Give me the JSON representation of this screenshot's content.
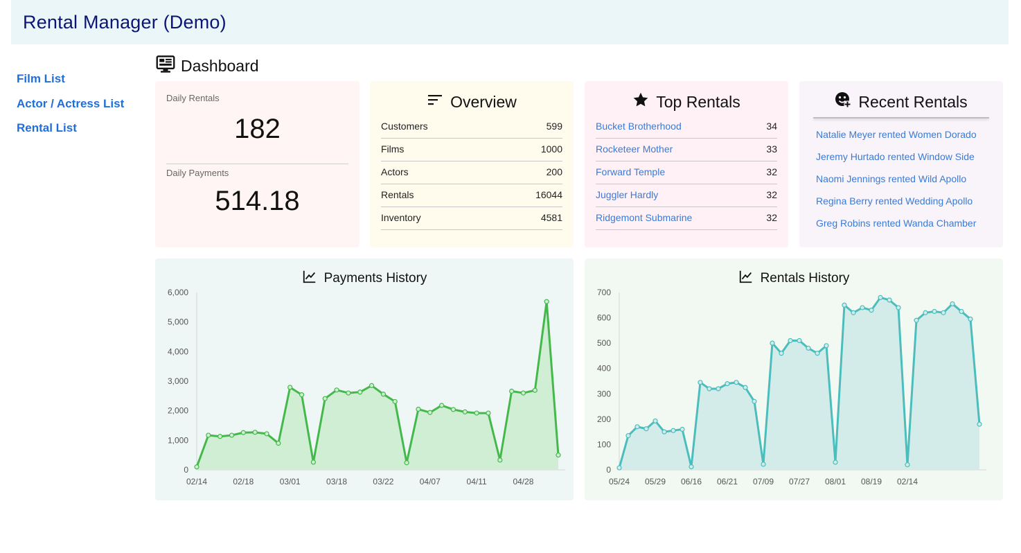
{
  "app": {
    "title": "Rental Manager (Demo)"
  },
  "sidebar": {
    "items": [
      {
        "label": "Film List"
      },
      {
        "label": "Actor / Actress List"
      },
      {
        "label": "Rental List"
      }
    ]
  },
  "dashboard": {
    "title": "Dashboard",
    "icon": "monitor-icon"
  },
  "daily": {
    "rentals_label": "Daily Rentals",
    "rentals_value": "182",
    "payments_label": "Daily Payments",
    "payments_value": "514.18"
  },
  "overview": {
    "title": "Overview",
    "icon": "sort-lines-icon",
    "rows": [
      {
        "label": "Customers",
        "value": "599"
      },
      {
        "label": "Films",
        "value": "1000"
      },
      {
        "label": "Actors",
        "value": "200"
      },
      {
        "label": "Rentals",
        "value": "16044"
      },
      {
        "label": "Inventory",
        "value": "4581"
      }
    ]
  },
  "top_rentals": {
    "title": "Top Rentals",
    "icon": "star-icon",
    "rows": [
      {
        "label": "Bucket Brotherhood",
        "value": "34"
      },
      {
        "label": "Rocketeer Mother",
        "value": "33"
      },
      {
        "label": "Forward Temple",
        "value": "32"
      },
      {
        "label": "Juggler Hardly",
        "value": "32"
      },
      {
        "label": "Ridgemont Submarine",
        "value": "32"
      }
    ]
  },
  "recent_rentals": {
    "title": "Recent Rentals",
    "icon": "emoji-add-icon",
    "items": [
      "Natalie Meyer rented Women Dorado",
      "Jeremy Hurtado rented Window Side",
      "Naomi Jennings rented Wild Apollo",
      "Regina Berry rented Wedding Apollo",
      "Greg Robins rented Wanda Chamber"
    ]
  },
  "colors": {
    "accent_blue": "#1f6fdb",
    "title_navy": "#0b1574",
    "payments_line": "#45b84b",
    "payments_fill": "#cfeed3",
    "rentals_line": "#4bbdbd",
    "rentals_fill": "#d3ecea"
  },
  "chart_data": [
    {
      "type": "area",
      "title": "Payments History",
      "icon": "line-chart-icon",
      "xlabel": "",
      "ylabel": "",
      "ylim": [
        0,
        6000
      ],
      "yticks": [
        "0",
        "1,000",
        "2,000",
        "3,000",
        "4,000",
        "5,000",
        "6,000"
      ],
      "ytick_values": [
        0,
        1000,
        2000,
        3000,
        4000,
        5000,
        6000
      ],
      "x": [
        "02/14",
        "02/15",
        "02/16",
        "02/17",
        "02/18",
        "02/19",
        "02/20",
        "02/21",
        "03/01",
        "03/02",
        "03/03",
        "03/18",
        "03/19",
        "03/20",
        "03/21",
        "03/22",
        "03/23",
        "03/24",
        "04/06",
        "04/07",
        "04/08",
        "04/09",
        "04/10",
        "04/11",
        "04/12",
        "04/27",
        "04/28",
        "04/29",
        "04/30",
        "05/01",
        "05/02",
        "05/03"
      ],
      "xtick_labels": [
        "02/14",
        "02/18",
        "03/01",
        "03/18",
        "03/22",
        "04/07",
        "04/11",
        "04/28"
      ],
      "xtick_index": [
        0,
        4,
        8,
        12,
        16,
        20,
        24,
        28
      ],
      "series": [
        {
          "values": [
            100,
            1170,
            1130,
            1170,
            1260,
            1270,
            1220,
            900,
            2790,
            2540,
            260,
            2410,
            2700,
            2600,
            2630,
            2850,
            2560,
            2310,
            240,
            2050,
            1940,
            2180,
            2040,
            1960,
            1920,
            1920,
            330,
            2660,
            2600,
            2690,
            5690,
            500
          ]
        }
      ],
      "grid": false
    },
    {
      "type": "area",
      "title": "Rentals History",
      "icon": "line-chart-icon",
      "xlabel": "",
      "ylabel": "",
      "ylim": [
        0,
        700
      ],
      "yticks": [
        "0",
        "100",
        "200",
        "300",
        "400",
        "500",
        "600",
        "700"
      ],
      "ytick_values": [
        0,
        100,
        200,
        300,
        400,
        500,
        600,
        700
      ],
      "x": [
        "05/24",
        "05/25",
        "05/26",
        "05/27",
        "05/28",
        "05/29",
        "05/30",
        "05/31",
        "06/01",
        "06/14",
        "06/15",
        "06/16",
        "06/17",
        "06/18",
        "06/19",
        "06/20",
        "06/21",
        "06/22",
        "07/05",
        "07/06",
        "07/07",
        "07/08",
        "07/09",
        "07/10",
        "07/11",
        "07/12",
        "07/26",
        "07/27",
        "07/28",
        "07/29",
        "07/30",
        "07/31",
        "08/01",
        "08/02",
        "08/16",
        "08/17",
        "08/18",
        "08/19",
        "08/20",
        "08/21",
        "08/22",
        "08/23",
        "02/14"
      ],
      "xtick_labels": [
        "05/24",
        "05/29",
        "06/16",
        "06/21",
        "07/09",
        "07/27",
        "08/01",
        "08/19",
        "02/14"
      ],
      "xtick_index": [
        0,
        4,
        8,
        12,
        16,
        20,
        24,
        28,
        32
      ],
      "series": [
        {
          "values": [
            8,
            135,
            170,
            162,
            193,
            150,
            155,
            160,
            12,
            345,
            320,
            320,
            340,
            345,
            325,
            270,
            22,
            500,
            460,
            510,
            510,
            480,
            460,
            490,
            30,
            650,
            620,
            640,
            630,
            680,
            670,
            640,
            20,
            590,
            620,
            625,
            620,
            655,
            625,
            595,
            180
          ]
        }
      ],
      "grid": false
    }
  ]
}
